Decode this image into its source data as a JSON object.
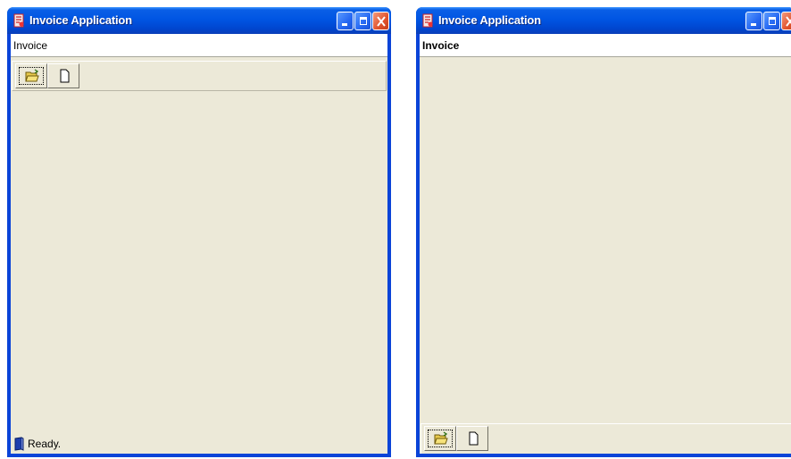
{
  "windows": [
    {
      "title": "Invoice Application",
      "menu": [
        "Invoice"
      ],
      "toolbar": {
        "position": "top",
        "buttons": [
          {
            "name": "open",
            "icon": "open-folder-icon",
            "focused": true
          },
          {
            "name": "new",
            "icon": "new-document-icon",
            "focused": false
          }
        ]
      },
      "status": "Ready."
    },
    {
      "title": "Invoice Application",
      "menu": [
        "Invoice"
      ],
      "toolbar": {
        "position": "bottom",
        "buttons": [
          {
            "name": "open",
            "icon": "open-folder-icon",
            "focused": true
          },
          {
            "name": "new",
            "icon": "new-document-icon",
            "focused": false
          }
        ]
      }
    }
  ],
  "colors": {
    "titlebar": "#0055e3",
    "client": "#ece9d8",
    "close_button": "#e0522c"
  }
}
